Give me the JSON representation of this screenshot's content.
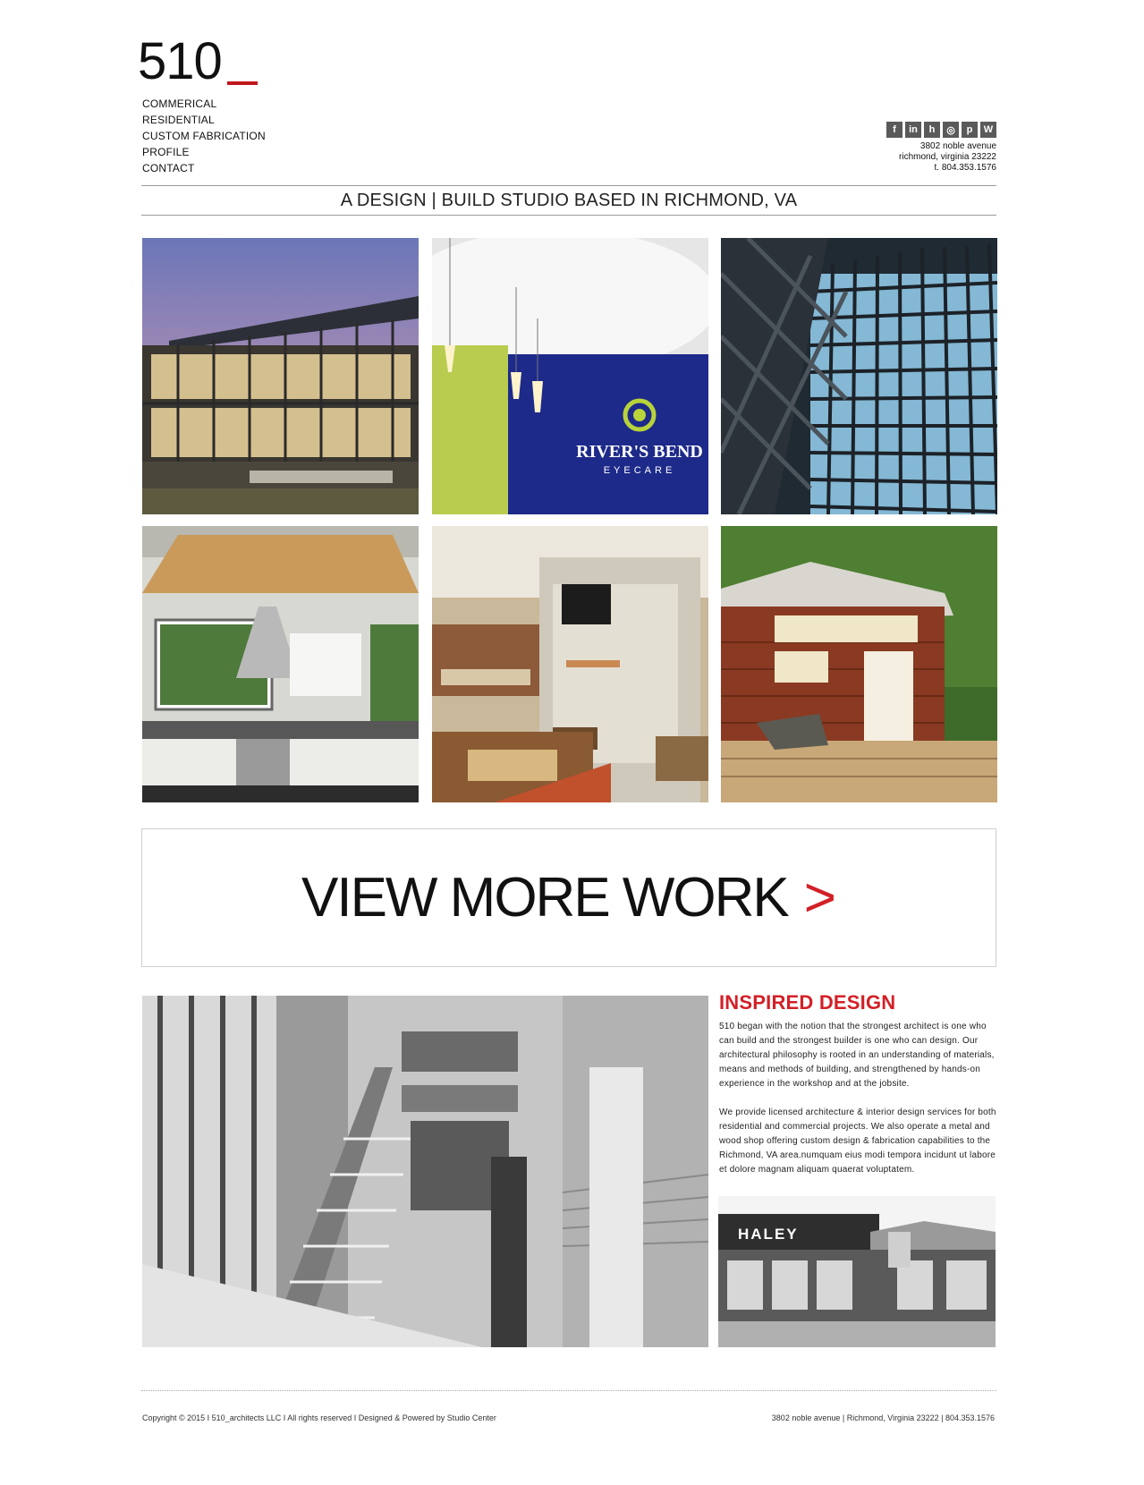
{
  "logo": {
    "text": "510"
  },
  "nav": [
    "COMMERICAL",
    "RESIDENTIAL",
    "CUSTOM FABRICATION",
    "PROFILE",
    "CONTACT"
  ],
  "social": [
    {
      "name": "facebook-icon",
      "glyph": "f"
    },
    {
      "name": "linkedin-icon",
      "glyph": "in"
    },
    {
      "name": "houzz-icon",
      "glyph": "h"
    },
    {
      "name": "instagram-icon",
      "glyph": "◎"
    },
    {
      "name": "pinterest-icon",
      "glyph": "p"
    },
    {
      "name": "wordpress-icon",
      "glyph": "W"
    }
  ],
  "address": {
    "line1": "3802 noble avenue",
    "line2": "richmond, virginia 23222",
    "line3": "t. 804.353.1576"
  },
  "tagline": "A DESIGN | BUILD STUDIO BASED IN RICHMOND, VA",
  "gallery": {
    "tile2_sign": "RIVER'S BEND",
    "tile2_sub": "EYECARE"
  },
  "view_more": {
    "label": "VIEW MORE WORK",
    "arrow": ">"
  },
  "about": {
    "title": "INSPIRED DESIGN",
    "p1": "510 began with the notion that the strongest architect is one who can build and the strongest builder is one who can design. Our architectural philosophy is rooted in an understanding of materials, means and methods of building, and strengthened by hands-on experience in the workshop and at the jobsite.",
    "p2": "We provide licensed architecture & interior design services for both residential and commercial projects. We also operate a metal and wood shop offering custom design & fabrication capabilities to the Richmond, VA area.numquam eius modi tempora incidunt ut labore et dolore magnam aliquam quaerat voluptatem.",
    "photo_sign": "HALEY"
  },
  "footer": {
    "left": "Copyright © 2015 I 510_architects LLC I All rights reserved  I  Designed & Powered by Studio Center",
    "right": "3802 noble avenue   |   Richmond, Virginia 23222   |   804.353.1576"
  },
  "colors": {
    "accent": "#d32027",
    "logo_bar": "#c0171d",
    "text": "#111111"
  }
}
